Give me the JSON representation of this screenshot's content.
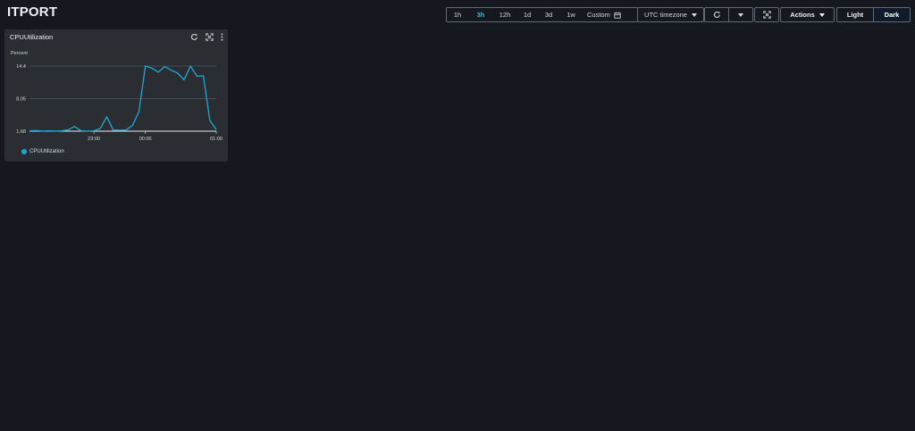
{
  "app": {
    "title": "ITPORT"
  },
  "toolbar": {
    "ranges": [
      {
        "label": "1h",
        "active": false
      },
      {
        "label": "3h",
        "active": true
      },
      {
        "label": "12h",
        "active": false
      },
      {
        "label": "1d",
        "active": false
      },
      {
        "label": "3d",
        "active": false
      },
      {
        "label": "1w",
        "active": false
      }
    ],
    "custom_label": "Custom",
    "timezone_label": "UTC timezone",
    "actions_label": "Actions",
    "theme": {
      "light_label": "Light",
      "dark_label": "Dark",
      "selected": "Dark"
    }
  },
  "colors": {
    "accent": "#44b9d6",
    "series": "#1ea7d4"
  },
  "widget": {
    "title": "CPUUtilization",
    "icons": [
      "refresh-icon",
      "expand-icon",
      "more-vertical-icon"
    ]
  },
  "chart_data": {
    "type": "line",
    "ylabel": "Percent",
    "yticks": [
      "14.4",
      "8.05",
      "1.68"
    ],
    "xticks": [
      "23:00",
      "00:00",
      "01:00"
    ],
    "ylim": [
      1.68,
      14.4
    ],
    "grid": true,
    "legend_position": "bottom-left",
    "series": [
      {
        "name": "CPUUtilization",
        "points": [
          [
            0,
            1.75
          ],
          [
            1,
            1.8
          ],
          [
            2,
            1.7
          ],
          [
            3,
            1.75
          ],
          [
            4,
            1.72
          ],
          [
            5,
            1.75
          ],
          [
            6,
            1.9
          ],
          [
            7,
            2.6
          ],
          [
            8,
            1.75
          ],
          [
            9,
            1.7
          ],
          [
            10,
            1.75
          ],
          [
            11,
            2.2
          ],
          [
            12,
            4.5
          ],
          [
            13,
            1.9
          ],
          [
            14,
            1.85
          ],
          [
            15,
            1.9
          ],
          [
            16,
            2.8
          ],
          [
            17,
            5.5
          ],
          [
            18,
            14.4
          ],
          [
            19,
            14.0
          ],
          [
            20,
            13.2
          ],
          [
            21,
            14.3
          ],
          [
            22,
            13.6
          ],
          [
            23,
            13.0
          ],
          [
            24,
            11.7
          ],
          [
            25,
            14.4
          ],
          [
            26,
            12.4
          ],
          [
            27,
            12.5
          ],
          [
            28,
            3.8
          ],
          [
            29,
            2.0
          ]
        ]
      }
    ]
  }
}
